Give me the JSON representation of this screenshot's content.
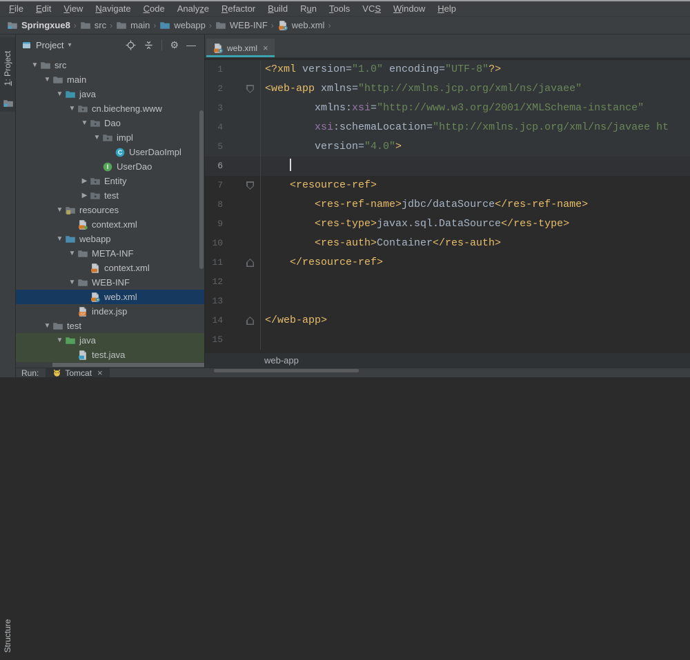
{
  "menu_bar": {
    "items": [
      {
        "label": "File",
        "u": 0
      },
      {
        "label": "Edit",
        "u": 0
      },
      {
        "label": "View",
        "u": 0
      },
      {
        "label": "Navigate",
        "u": 0
      },
      {
        "label": "Code",
        "u": 0
      },
      {
        "label": "Analyze",
        "u": 5
      },
      {
        "label": "Refactor",
        "u": 0
      },
      {
        "label": "Build",
        "u": 0
      },
      {
        "label": "Run",
        "u": 1
      },
      {
        "label": "Tools",
        "u": 0
      },
      {
        "label": "VCS",
        "u": 2
      },
      {
        "label": "Window",
        "u": 0
      },
      {
        "label": "Help",
        "u": 0
      }
    ]
  },
  "nav_bar": {
    "crumbs": [
      {
        "label": "Springxue8",
        "icon": "project",
        "bold": true
      },
      {
        "label": "src",
        "icon": "folder"
      },
      {
        "label": "main",
        "icon": "folder"
      },
      {
        "label": "webapp",
        "icon": "folder-web"
      },
      {
        "label": "WEB-INF",
        "icon": "folder"
      },
      {
        "label": "web.xml",
        "icon": "xml-web"
      }
    ]
  },
  "left_stripe": {
    "top_tab": {
      "label": "1: Project",
      "u": 0
    },
    "bottom_tab": {
      "label": "Structure"
    }
  },
  "project_panel": {
    "title": "Project",
    "header_icons": [
      "locate",
      "collapse-all",
      "|",
      "settings",
      "hide"
    ],
    "tree": [
      {
        "level": 0,
        "arrow": "open",
        "icon": "folder",
        "label": "src"
      },
      {
        "level": 1,
        "arrow": "open",
        "icon": "folder",
        "label": "main"
      },
      {
        "level": 2,
        "arrow": "open",
        "icon": "folder-src",
        "label": "java"
      },
      {
        "level": 3,
        "arrow": "open",
        "icon": "package",
        "label": "cn.biecheng.www"
      },
      {
        "level": 4,
        "arrow": "open",
        "icon": "package",
        "label": "Dao"
      },
      {
        "level": 5,
        "arrow": "open",
        "icon": "package",
        "label": "impl"
      },
      {
        "level": 6,
        "arrow": "none",
        "icon": "class",
        "label": "UserDaoImpl"
      },
      {
        "level": 5,
        "arrow": "none",
        "icon": "interface",
        "label": "UserDao"
      },
      {
        "level": 4,
        "arrow": "closed",
        "icon": "package",
        "label": "Entity"
      },
      {
        "level": 4,
        "arrow": "closed",
        "icon": "package",
        "label": "test"
      },
      {
        "level": 2,
        "arrow": "open",
        "icon": "folder-res",
        "label": "resources"
      },
      {
        "level": 3,
        "arrow": "none",
        "icon": "xml-ctx",
        "label": "context.xml"
      },
      {
        "level": 2,
        "arrow": "open",
        "icon": "folder-web",
        "label": "webapp"
      },
      {
        "level": 3,
        "arrow": "open",
        "icon": "folder",
        "label": "META-INF"
      },
      {
        "level": 4,
        "arrow": "none",
        "icon": "xml",
        "label": "context.xml"
      },
      {
        "level": 3,
        "arrow": "open",
        "icon": "folder",
        "label": "WEB-INF"
      },
      {
        "level": 4,
        "arrow": "none",
        "icon": "xml-web",
        "label": "web.xml",
        "hl": "selected"
      },
      {
        "level": 3,
        "arrow": "none",
        "icon": "jsp",
        "label": "index.jsp"
      },
      {
        "level": 1,
        "arrow": "open",
        "icon": "folder",
        "label": "test"
      },
      {
        "level": 2,
        "arrow": "open",
        "icon": "folder-test",
        "label": "java",
        "hl": "test"
      },
      {
        "level": 3,
        "arrow": "none",
        "icon": "java-file",
        "label": "test.java",
        "hl": "test"
      }
    ]
  },
  "editor": {
    "tab": {
      "label": "web.xml",
      "icon": "xml-web"
    },
    "breadcrumb": "web-app",
    "code": {
      "lines": [
        {
          "n": 1,
          "bg": "band",
          "seg": [
            [
              "t",
              "<?xml "
            ],
            [
              "a",
              "version="
            ],
            [
              "s",
              "\"1.0\""
            ],
            [
              "a",
              " encoding="
            ],
            [
              "s",
              "\"UTF-8\""
            ],
            [
              "t",
              "?>"
            ]
          ]
        },
        {
          "n": 2,
          "bg": "band",
          "fold": "down",
          "seg": [
            [
              "t",
              "<web-app "
            ],
            [
              "a",
              "xmlns="
            ],
            [
              "s",
              "\"http://xmlns.jcp.org/xml/ns/javaee\""
            ]
          ]
        },
        {
          "n": 3,
          "bg": "band",
          "seg": [
            [
              "a",
              "        xmlns:"
            ],
            [
              "n2",
              "xsi"
            ],
            [
              "a",
              "="
            ],
            [
              "s",
              "\"http://www.w3.org/2001/XMLSchema-instance\""
            ]
          ]
        },
        {
          "n": 4,
          "bg": "band",
          "seg": [
            [
              "n2",
              "        xsi"
            ],
            [
              "a",
              ":schemaLocation="
            ],
            [
              "s",
              "\"http://xmlns.jcp.org/xml/ns/javaee ht"
            ]
          ]
        },
        {
          "n": 5,
          "bg": "band",
          "seg": [
            [
              "a",
              "        version="
            ],
            [
              "s",
              "\"4.0\""
            ],
            [
              "t",
              ">"
            ]
          ]
        },
        {
          "n": 6,
          "bg": "cur",
          "seg": [
            [
              "w",
              "    "
            ],
            [
              "caret",
              ""
            ]
          ]
        },
        {
          "n": 7,
          "fold": "down",
          "seg": [
            [
              "t",
              "    <resource-ref>"
            ]
          ]
        },
        {
          "n": 8,
          "seg": [
            [
              "t",
              "        <res-ref-name>"
            ],
            [
              "x",
              "jdbc/dataSource"
            ],
            [
              "t",
              "</res-ref-name>"
            ]
          ]
        },
        {
          "n": 9,
          "seg": [
            [
              "t",
              "        <res-type>"
            ],
            [
              "x",
              "javax.sql.DataSource"
            ],
            [
              "t",
              "</res-type>"
            ]
          ]
        },
        {
          "n": 10,
          "seg": [
            [
              "t",
              "        <res-auth>"
            ],
            [
              "x",
              "Container"
            ],
            [
              "t",
              "</res-auth>"
            ]
          ]
        },
        {
          "n": 11,
          "fold": "up",
          "seg": [
            [
              "t",
              "    </resource-ref>"
            ]
          ]
        },
        {
          "n": 12,
          "seg": []
        },
        {
          "n": 13,
          "seg": []
        },
        {
          "n": 14,
          "fold": "up",
          "seg": [
            [
              "t",
              "</web-app>"
            ]
          ]
        },
        {
          "n": 15,
          "seg": []
        }
      ]
    }
  },
  "run_bar": {
    "label": "Run:",
    "tab": {
      "label": "Tomcat",
      "icon": "tomcat"
    }
  },
  "colors": {
    "accent_tab_underline": "#3aa3ad",
    "tree_selection": "#16395f",
    "tree_test_row": "#3e4b38",
    "panel_bg": "#3c3f41",
    "editor_bg": "#2b2b2b",
    "syntax": {
      "t": "#e8bf6a",
      "a": "#a9b7c6",
      "n2": "#9876aa",
      "s": "#6a8759",
      "x": "#a9b7c6",
      "w": "#a9b7c6"
    }
  }
}
